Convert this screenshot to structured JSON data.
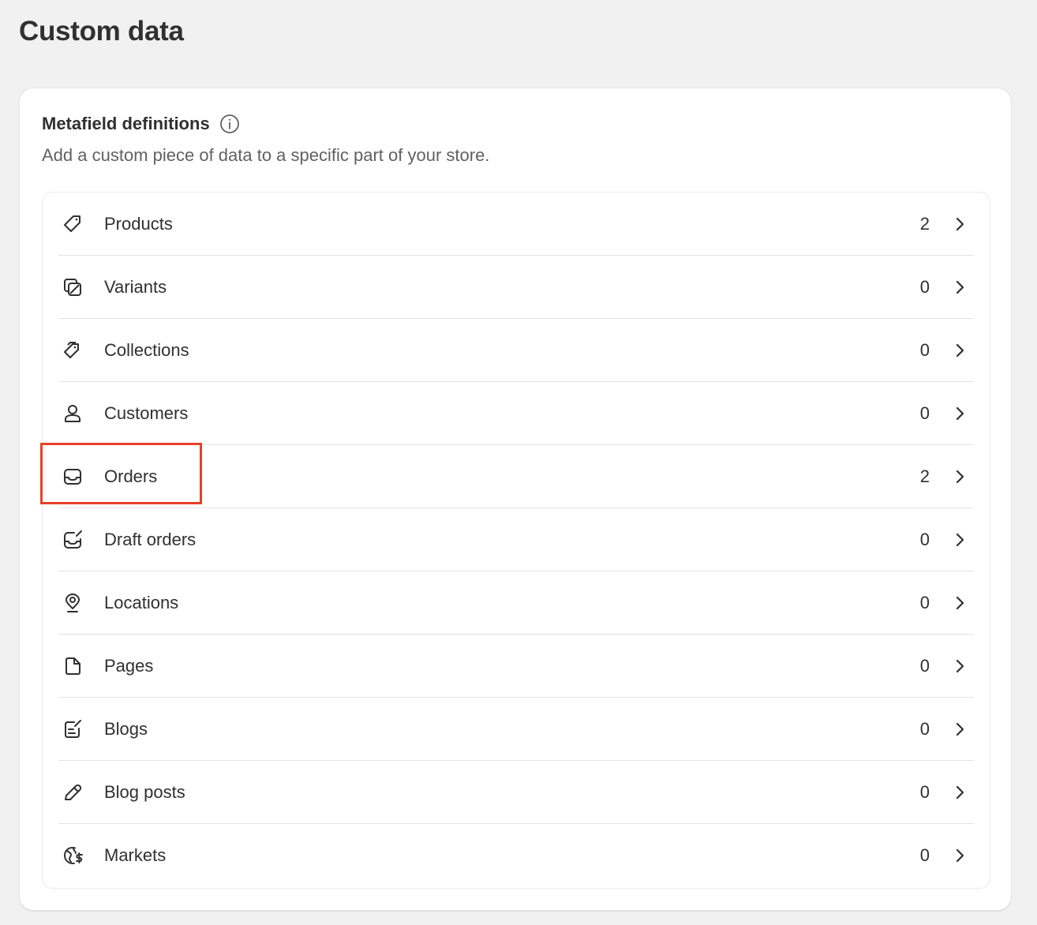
{
  "page": {
    "title": "Custom data"
  },
  "card": {
    "title": "Metafield definitions",
    "description": "Add a custom piece of data to a specific part of your store."
  },
  "items": [
    {
      "label": "Products",
      "count": "2",
      "icon": "tag-icon"
    },
    {
      "label": "Variants",
      "count": "0",
      "icon": "variant-icon"
    },
    {
      "label": "Collections",
      "count": "0",
      "icon": "collection-icon"
    },
    {
      "label": "Customers",
      "count": "0",
      "icon": "person-icon"
    },
    {
      "label": "Orders",
      "count": "2",
      "icon": "inbox-icon"
    },
    {
      "label": "Draft orders",
      "count": "0",
      "icon": "draft-order-icon"
    },
    {
      "label": "Locations",
      "count": "0",
      "icon": "location-pin-icon"
    },
    {
      "label": "Pages",
      "count": "0",
      "icon": "page-icon"
    },
    {
      "label": "Blogs",
      "count": "0",
      "icon": "blog-icon"
    },
    {
      "label": "Blog posts",
      "count": "0",
      "icon": "pencil-icon"
    },
    {
      "label": "Markets",
      "count": "0",
      "icon": "globe-market-icon"
    }
  ],
  "colors": {
    "highlight": "#e8402a",
    "text": "#303030",
    "muted": "#616161"
  }
}
